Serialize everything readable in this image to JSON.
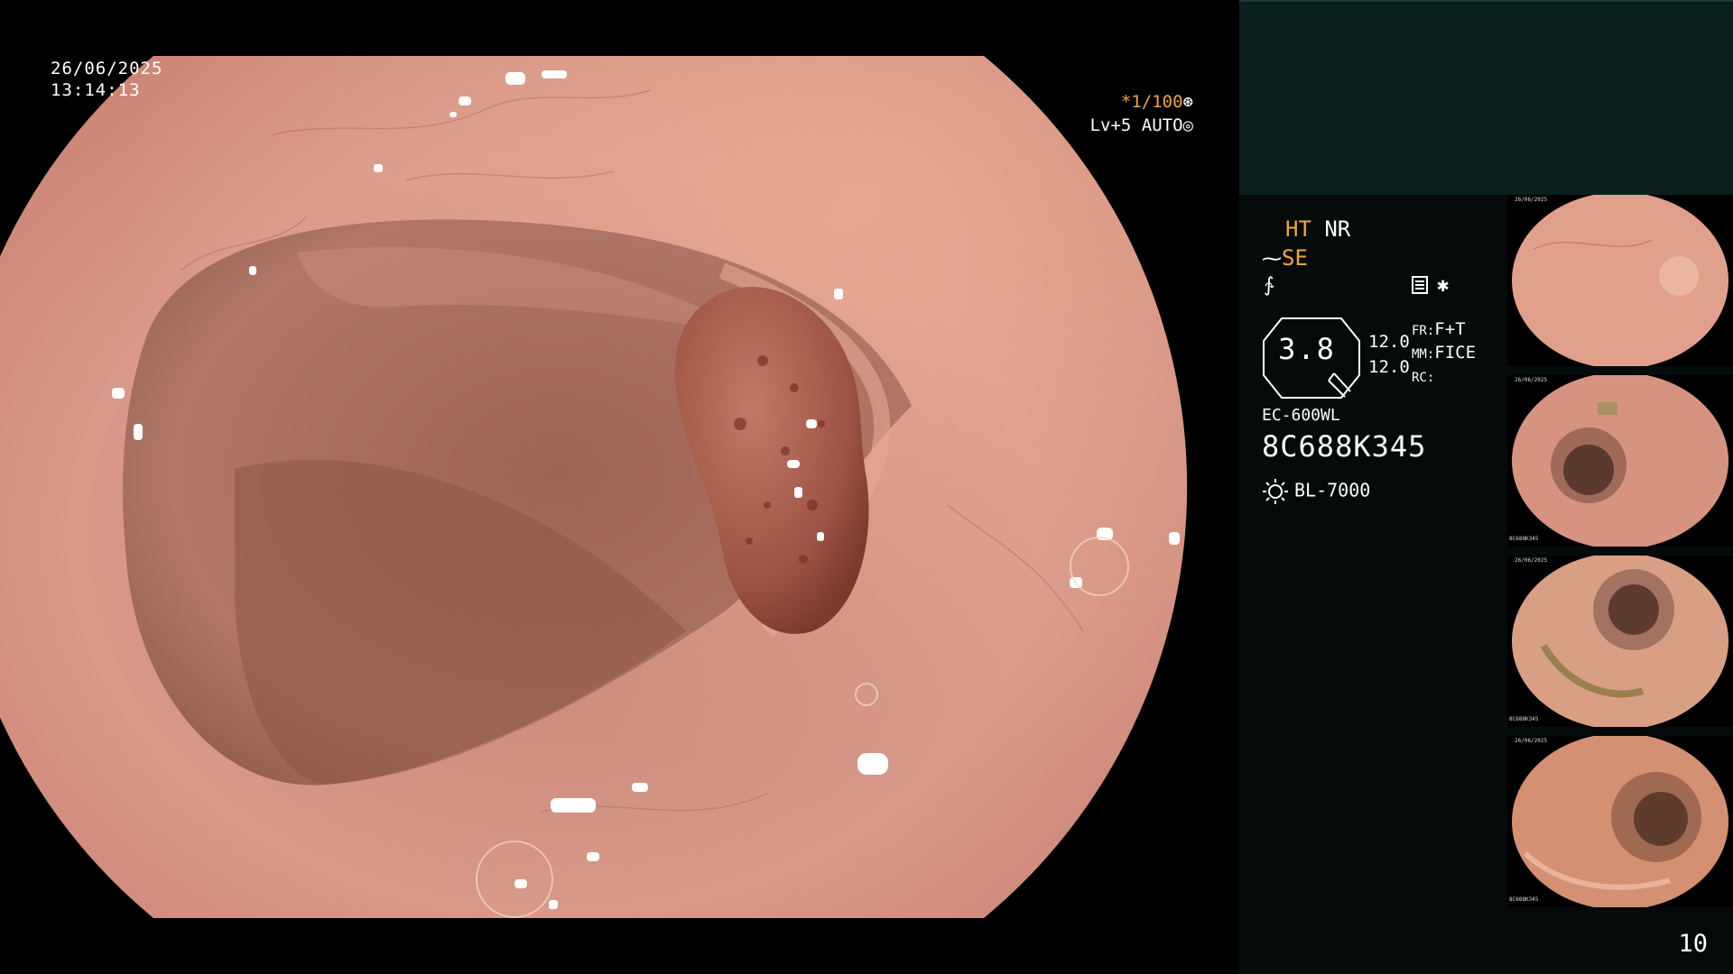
{
  "overlay": {
    "date": "26/06/2025",
    "time": "13:14:13",
    "shutter_value": "*1/100",
    "iris_text": "Lv+5 AUTO"
  },
  "panel": {
    "ht": "HT",
    "nr": "NR",
    "se": "SE",
    "zoom": "3.8",
    "fr_label": "FR:",
    "fr_value": "F+T",
    "mm_label": "MM:",
    "mm_value": "FICE",
    "rc_label": "RC:",
    "val_1": "12.0",
    "val_2": "12.0",
    "scope_model": "EC-600WL",
    "scope_serial": "8C688K345",
    "light_source": "BL-7000",
    "page_number": "10"
  },
  "thumbnails": [
    {
      "caption_date": "26/06/2025",
      "caption_serial": ""
    },
    {
      "caption_date": "26/06/2025",
      "caption_serial": "8C688K345"
    },
    {
      "caption_date": "26/06/2025",
      "caption_serial": "8C688K345"
    },
    {
      "caption_date": "26/06/2025",
      "caption_serial": "8C688K345"
    }
  ],
  "colors": {
    "amber": "#f0a53a",
    "panel_bg": "#050b0a",
    "panel_top_bg": "#0c1f1f",
    "mucosa": "#d38f7d"
  }
}
